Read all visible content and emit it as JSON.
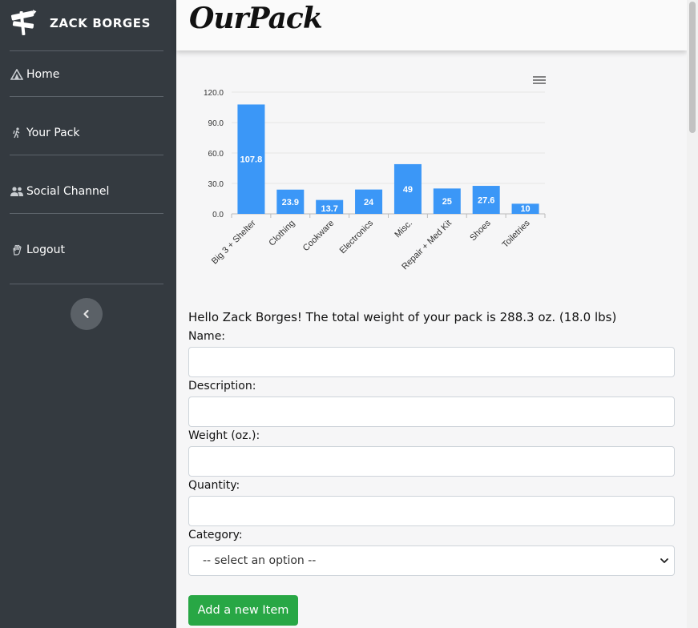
{
  "sidebar": {
    "brand_name": "ZACK BORGES",
    "items": [
      {
        "label": "Home",
        "icon": "tent-icon"
      },
      {
        "label": "Your Pack",
        "icon": "hiker-icon"
      },
      {
        "label": "Social Channel",
        "icon": "users-icon"
      },
      {
        "label": "Logout",
        "icon": "hand-wave-icon"
      }
    ],
    "collapse_icon": "chevron-left-icon"
  },
  "header": {
    "title": "OurPack"
  },
  "chart_data": {
    "type": "bar",
    "categories": [
      "Big 3 + Shelter",
      "Clothing",
      "Cookware",
      "Electronics",
      "Misc.",
      "Repair + Med Kit",
      "Shoes",
      "Toiletries"
    ],
    "values": [
      107.8,
      23.9,
      13.7,
      24,
      49,
      25,
      27.6,
      10
    ],
    "data_labels": [
      "107.8",
      "23.9",
      "13.7",
      "24",
      "49",
      "25",
      "27.6",
      "10"
    ],
    "yticks": [
      "0.0",
      "30.0",
      "60.0",
      "90.0",
      "120.0"
    ],
    "ylim": [
      0,
      120
    ],
    "grid": true,
    "color": "#3b97f7",
    "menu_icon": "hamburger-menu-icon"
  },
  "form": {
    "greeting": "Hello Zack Borges! The total weight of your pack is 288.3 oz. (18.0 lbs)",
    "name_label": "Name:",
    "name_value": "",
    "description_label": "Description:",
    "description_value": "",
    "weight_label": "Weight (oz.):",
    "weight_value": "",
    "quantity_label": "Quantity:",
    "quantity_value": "",
    "category_label": "Category:",
    "category_selected": "-- select an option --",
    "submit_label": "Add a new Item"
  },
  "colors": {
    "sidebar_bg": "#343a40",
    "accent_green": "#28a745",
    "bar_blue": "#3b97f7"
  }
}
